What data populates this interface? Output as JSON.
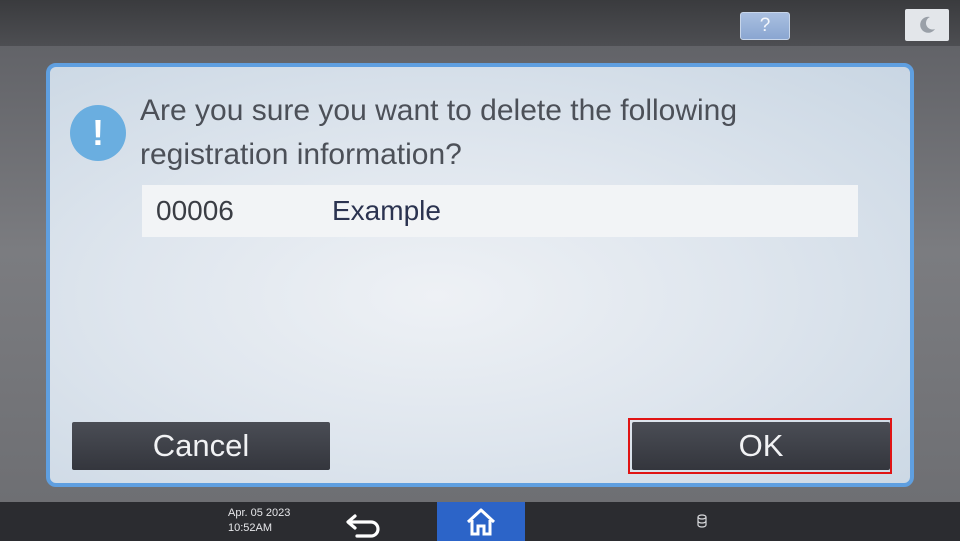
{
  "header": {
    "help_label": "?",
    "help_icon": "help-icon",
    "energy_icon": "moon-icon"
  },
  "dialog": {
    "icon": "exclamation-icon",
    "icon_glyph": "!",
    "message_line1": "Are you sure you want to delete the following",
    "message_line2": "registration information?",
    "entry": {
      "number": "00006",
      "name": "Example"
    },
    "cancel_label": "Cancel",
    "ok_label": "OK"
  },
  "footer": {
    "date": "Apr. 05 2023",
    "time": "10:52AM",
    "back_icon": "back-arrow-icon",
    "home_icon": "home-icon",
    "status_icon": "storage-icon"
  },
  "colors": {
    "dialog_border": "#5f9fe0",
    "alert_icon": "#6aaee0",
    "button_bg": "#3f4148",
    "home_active": "#2c64c8",
    "highlight": "#e01414"
  }
}
